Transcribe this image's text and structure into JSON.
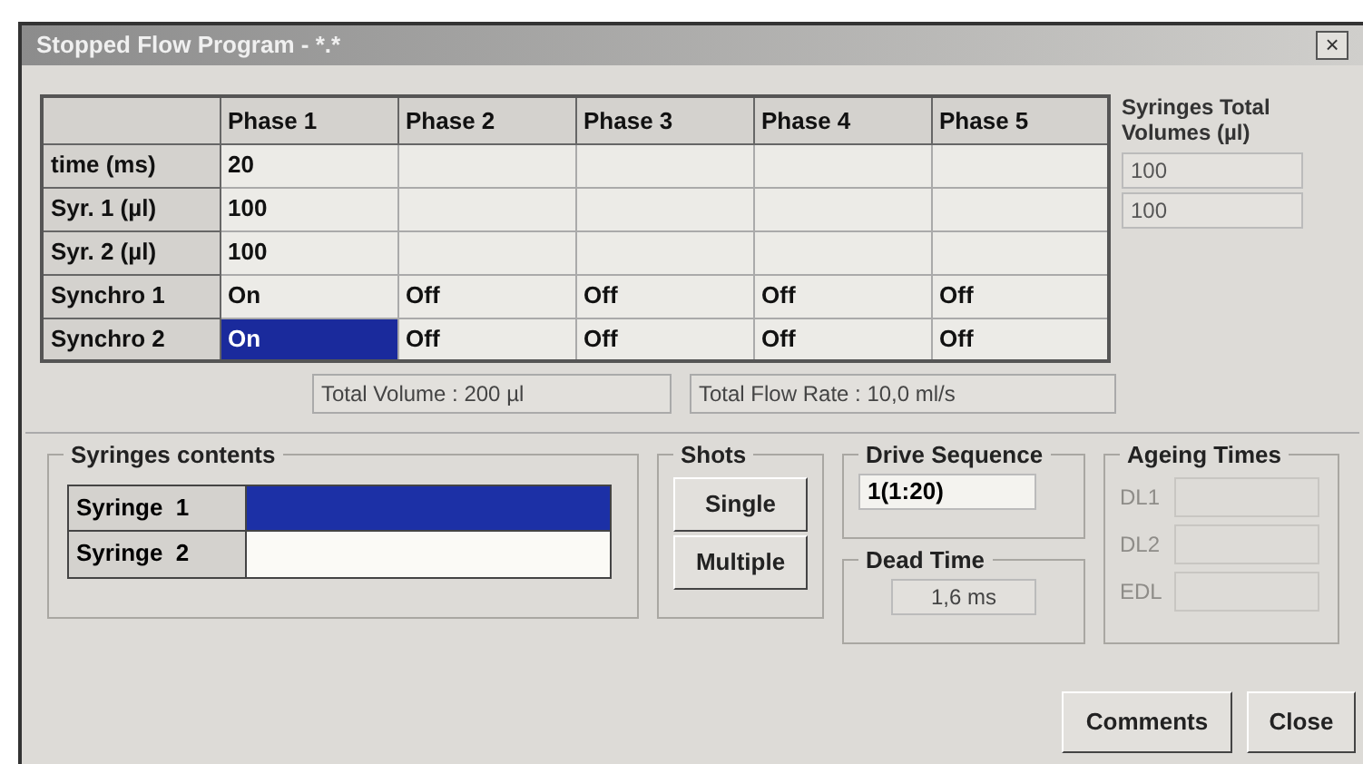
{
  "window": {
    "title": "Stopped Flow Program - *.*",
    "close": "×"
  },
  "table": {
    "columns": [
      "Phase 1",
      "Phase 2",
      "Phase 3",
      "Phase 4",
      "Phase 5"
    ],
    "rows": [
      {
        "label": "time (ms)",
        "cells": [
          {
            "text": "20",
            "selected": false
          },
          {
            "text": "",
            "selected": false
          },
          {
            "text": "",
            "selected": false
          },
          {
            "text": "",
            "selected": false
          },
          {
            "text": "",
            "selected": false
          }
        ]
      },
      {
        "label": "Syr. 1 (µl)",
        "cells": [
          {
            "text": "100",
            "selected": false
          },
          {
            "text": "",
            "selected": false
          },
          {
            "text": "",
            "selected": false
          },
          {
            "text": "",
            "selected": false
          },
          {
            "text": "",
            "selected": false
          }
        ]
      },
      {
        "label": "Syr. 2 (µl)",
        "cells": [
          {
            "text": "100",
            "selected": false
          },
          {
            "text": "",
            "selected": false
          },
          {
            "text": "",
            "selected": false
          },
          {
            "text": "",
            "selected": false
          },
          {
            "text": "",
            "selected": false
          }
        ]
      },
      {
        "label": "Synchro 1",
        "cells": [
          {
            "text": "On",
            "selected": false
          },
          {
            "text": "Off",
            "selected": false
          },
          {
            "text": "Off",
            "selected": false
          },
          {
            "text": "Off",
            "selected": false
          },
          {
            "text": "Off",
            "selected": false
          }
        ]
      },
      {
        "label": "Synchro 2",
        "cells": [
          {
            "text": "On",
            "selected": true
          },
          {
            "text": "Off",
            "selected": false
          },
          {
            "text": "Off",
            "selected": false
          },
          {
            "text": "Off",
            "selected": false
          },
          {
            "text": "Off",
            "selected": false
          }
        ]
      }
    ]
  },
  "totals": {
    "heading": "Syringes Total Volumes (µl)",
    "values": [
      "100",
      "100"
    ]
  },
  "status": [
    "Total Volume : 200 µl",
    "Total Flow Rate : 10,0 ml/s"
  ],
  "syringes_contents": {
    "title": "Syringes contents",
    "items": [
      {
        "label": "Syringe  1",
        "color": "#1c30a6"
      },
      {
        "label": "Syringe  2",
        "color": "#fbfaf6"
      }
    ]
  },
  "shots": {
    "title": "Shots",
    "buttons": [
      "Single",
      "Multiple"
    ]
  },
  "drive_sequence": {
    "title": "Drive Sequence",
    "value": "1(1:20)"
  },
  "dead_time": {
    "title": "Dead Time",
    "value": "1,6 ms"
  },
  "ageing_times": {
    "title": "Ageing Times",
    "fields": [
      {
        "label": "DL1",
        "disabled": true
      },
      {
        "label": "DL2",
        "disabled": true
      },
      {
        "label": "EDL",
        "disabled": true
      }
    ]
  },
  "buttons": [
    "Comments",
    "Close"
  ]
}
